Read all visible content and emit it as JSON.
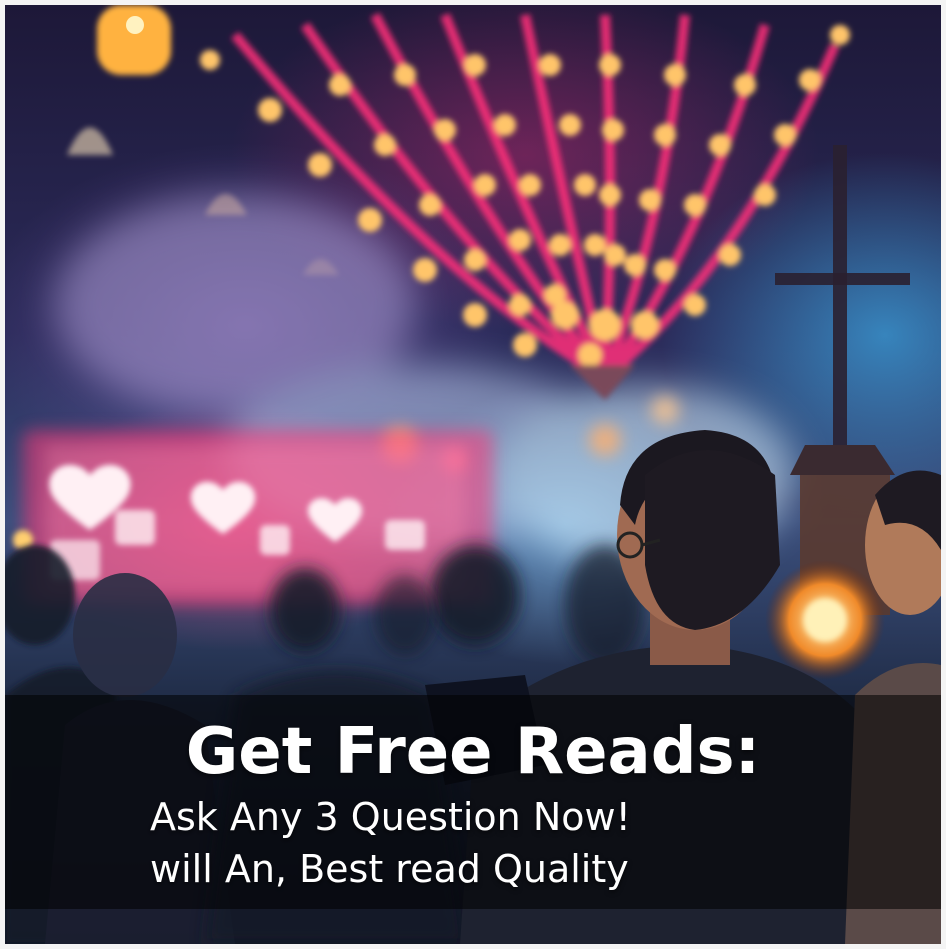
{
  "overlay": {
    "headline": "Get Free Reads:",
    "line1": "Ask Any 3 Question Now!",
    "line2": "will An, Best read Quality"
  },
  "colors": {
    "text": "#ffffff",
    "banner": "rgba(0,0,0,0.55)",
    "lights_pink": "#ff3d8b",
    "lights_gold": "#ffd27a",
    "ambient_blue": "#3caae6"
  }
}
